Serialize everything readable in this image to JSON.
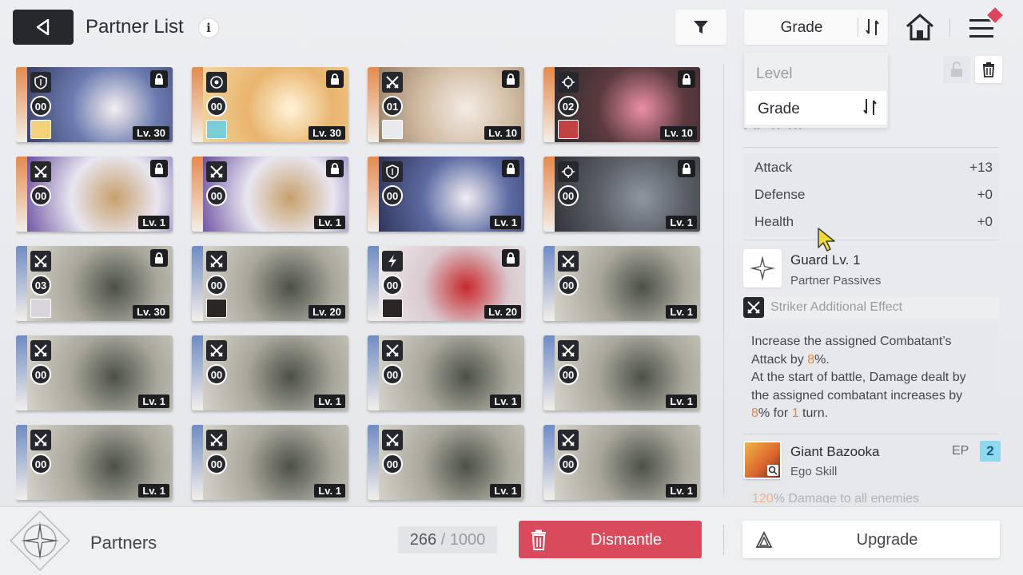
{
  "header": {
    "back_icon": "triangle-left-icon",
    "title": "Partner List",
    "info_label": "i",
    "sort_label": "Grade"
  },
  "sort_dropdown": {
    "options": [
      {
        "label": "Level",
        "selected": false
      },
      {
        "label": "Grade",
        "selected": true
      }
    ]
  },
  "partners": [
    {
      "role": "shield",
      "num": "00",
      "level": "Lv. 30",
      "locked": true,
      "stripe": "#e58a4b",
      "art": [
        "#3a3f66",
        "#6b7bb0",
        "#f5f0f0"
      ],
      "has_mini": true,
      "mini": "#f3d27a"
    },
    {
      "role": "target",
      "num": "00",
      "level": "Lv. 30",
      "locked": true,
      "stripe": "#e58a4b",
      "art": [
        "#f3d79e",
        "#e9b46e",
        "#fff4da"
      ],
      "has_mini": true,
      "mini": "#78cfd8"
    },
    {
      "role": "swords",
      "num": "01",
      "level": "Lv. 10",
      "locked": true,
      "stripe": "#e58a4b",
      "art": [
        "#9a8069",
        "#d4bfa7",
        "#f3ece5"
      ],
      "has_mini": true,
      "mini": "#e9e9ee"
    },
    {
      "role": "crosshair",
      "num": "02",
      "level": "Lv. 10",
      "locked": true,
      "stripe": "#e58a4b",
      "art": [
        "#2c2c30",
        "#5c3a3e",
        "#ec8fa7"
      ],
      "has_mini": true,
      "mini": "#c24242"
    },
    {
      "role": "swords",
      "num": "00",
      "level": "Lv. 1",
      "locked": true,
      "stripe": "#e58a4b",
      "art": [
        "#6a4ea0",
        "#e9e6f0",
        "#c7a06a"
      ],
      "has_mini": false,
      "mini": ""
    },
    {
      "role": "swords",
      "num": "00",
      "level": "Lv. 1",
      "locked": true,
      "stripe": "#e58a4b",
      "art": [
        "#6a4ea0",
        "#e9e6f0",
        "#c7a06a"
      ],
      "has_mini": false,
      "mini": ""
    },
    {
      "role": "shield",
      "num": "00",
      "level": "Lv. 1",
      "locked": true,
      "stripe": "#e58a4b",
      "art": [
        "#2e3357",
        "#5d6ba3",
        "#f1eef2"
      ],
      "has_mini": false,
      "mini": ""
    },
    {
      "role": "crosshair",
      "num": "00",
      "level": "Lv. 1",
      "locked": true,
      "stripe": "#e58a4b",
      "art": [
        "#303236",
        "#5b6068",
        "#8e96a0"
      ],
      "has_mini": false,
      "mini": ""
    },
    {
      "role": "swords",
      "num": "03",
      "level": "Lv. 30",
      "locked": true,
      "stripe": "#6e8cc4",
      "art": [
        "#d8d5cc",
        "#a9a69b",
        "#4b5146"
      ],
      "has_mini": true,
      "mini": "#d9d4dd"
    },
    {
      "role": "swords",
      "num": "00",
      "level": "Lv. 20",
      "locked": false,
      "stripe": "#6e8cc4",
      "art": [
        "#d8d5cc",
        "#a9a69b",
        "#4b5146"
      ],
      "has_mini": true,
      "mini": "#2b2526"
    },
    {
      "role": "bolt",
      "num": "00",
      "level": "Lv. 20",
      "locked": true,
      "stripe": "#6e8cc4",
      "art": [
        "#f0ecee",
        "#d9c9cf",
        "#c8282a"
      ],
      "has_mini": true,
      "mini": "#2b2526"
    },
    {
      "role": "swords",
      "num": "00",
      "level": "Lv. 1",
      "locked": false,
      "stripe": "#6e8cc4",
      "art": [
        "#d8d5cc",
        "#a9a69b",
        "#4b5146"
      ],
      "has_mini": false,
      "mini": ""
    },
    {
      "role": "swords",
      "num": "00",
      "level": "Lv. 1",
      "locked": false,
      "stripe": "#6e8cc4",
      "art": [
        "#d8d5cc",
        "#a9a69b",
        "#4b5146"
      ],
      "has_mini": false,
      "mini": ""
    },
    {
      "role": "swords",
      "num": "00",
      "level": "Lv. 1",
      "locked": false,
      "stripe": "#6e8cc4",
      "art": [
        "#d8d5cc",
        "#a9a69b",
        "#4b5146"
      ],
      "has_mini": false,
      "mini": ""
    },
    {
      "role": "swords",
      "num": "00",
      "level": "Lv. 1",
      "locked": false,
      "stripe": "#6e8cc4",
      "art": [
        "#d8d5cc",
        "#a9a69b",
        "#4b5146"
      ],
      "has_mini": false,
      "mini": ""
    },
    {
      "role": "swords",
      "num": "00",
      "level": "Lv. 1",
      "locked": false,
      "stripe": "#6e8cc4",
      "art": [
        "#d8d5cc",
        "#a9a69b",
        "#4b5146"
      ],
      "has_mini": false,
      "mini": ""
    },
    {
      "role": "swords",
      "num": "00",
      "level": "Lv. 1",
      "locked": false,
      "stripe": "#6e8cc4",
      "art": [
        "#d8d5cc",
        "#a9a69b",
        "#4b5146"
      ],
      "has_mini": false,
      "mini": ""
    },
    {
      "role": "swords",
      "num": "00",
      "level": "Lv. 1",
      "locked": false,
      "stripe": "#6e8cc4",
      "art": [
        "#d8d5cc",
        "#a9a69b",
        "#4b5146"
      ],
      "has_mini": false,
      "mini": ""
    },
    {
      "role": "swords",
      "num": "00",
      "level": "Lv. 1",
      "locked": false,
      "stripe": "#6e8cc4",
      "art": [
        "#d8d5cc",
        "#a9a69b",
        "#4b5146"
      ],
      "has_mini": false,
      "mini": ""
    },
    {
      "role": "swords",
      "num": "00",
      "level": "Lv. 1",
      "locked": false,
      "stripe": "#6e8cc4",
      "art": [
        "#d8d5cc",
        "#a9a69b",
        "#4b5146"
      ],
      "has_mini": false,
      "mini": ""
    }
  ],
  "panel": {
    "level_partial": "Lv. 1/ 10",
    "stats": [
      {
        "label": "Attack",
        "value": "+13"
      },
      {
        "label": "Defense",
        "value": "+0"
      },
      {
        "label": "Health",
        "value": "+0"
      }
    ],
    "skill": {
      "name": "Guard Lv. 1",
      "sub": "Partner Passives",
      "icon": "compass-star-icon"
    },
    "effect_label": "Striker Additional Effect",
    "description": {
      "l1": "Increase the assigned Combatant’s",
      "l2a": "Attack by ",
      "l2b": "8",
      "l2c": "%.",
      "l3": "At the start of battle, Damage dealt by",
      "l4": "the assigned combatant increases by",
      "l5a": "8",
      "l5b": "% for ",
      "l5c": "1",
      "l5d": " turn."
    },
    "ego": {
      "name": "Giant Bazooka",
      "sub": "Ego Skill",
      "ep_label": "EP",
      "ep_value": "2"
    },
    "cut_desc": {
      "hl": "120",
      "rest": "% Damage to all enemies"
    }
  },
  "bottom": {
    "label": "Partners",
    "count_current": "266",
    "count_sep": " / ",
    "count_total": "1000",
    "dismantle": "Dismantle",
    "upgrade": "Upgrade"
  },
  "colors": {
    "dismantle": "#d84a5c",
    "ep_badge": "#8ed8f0",
    "highlight": "#e8843d"
  }
}
